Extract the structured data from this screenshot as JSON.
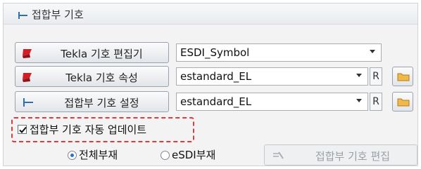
{
  "panel": {
    "title": "접합부 기호"
  },
  "rows": [
    {
      "button_label": "Tekla 기호 편집기",
      "icon": "red-flag-icon",
      "combo_value": "ESDI_Symbol",
      "has_r": false,
      "has_folder": false
    },
    {
      "button_label": "Tekla 기호 속성",
      "icon": "red-flag-icon",
      "combo_value": "estandard_EL",
      "has_r": true,
      "r_label": "R",
      "has_folder": true
    },
    {
      "button_label": "접합부 기호 설정",
      "icon": "joint-symbol-icon",
      "combo_value": "estandard_EL",
      "has_r": true,
      "r_label": "R",
      "has_folder": true
    }
  ],
  "auto_update": {
    "label": "접합부 기호 자동 업데이트",
    "checked": true
  },
  "scope": {
    "options": [
      "전체부재",
      "eSDI부재"
    ],
    "selected": "전체부재"
  },
  "edit_button": {
    "label": "접합부 기호 편집",
    "enabled": false
  },
  "colors": {
    "highlight_dash": "#e23a3a",
    "accent": "#2a6fd0"
  }
}
